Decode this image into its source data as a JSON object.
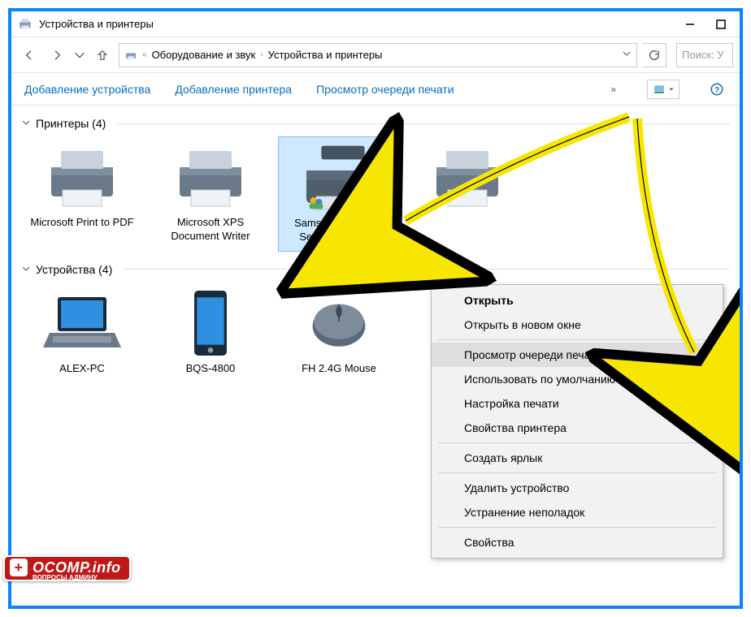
{
  "window": {
    "title": "Устройства и принтеры"
  },
  "breadcrumb": {
    "item1": "Оборудование и звук",
    "item2": "Устройства и принтеры"
  },
  "search": {
    "placeholder": "Поиск: У"
  },
  "toolbar": {
    "add_device": "Добавление устройства",
    "add_printer": "Добавление принтера",
    "view_queue": "Просмотр очереди печати"
  },
  "groups": {
    "printers": {
      "header": "Принтеры (4)",
      "items": [
        {
          "label": "Microsoft Print to PDF"
        },
        {
          "label": "Microsoft XPS Document Writer"
        },
        {
          "label": "Samsung ML-1860 Series (USB001)"
        },
        {
          "label": ""
        }
      ]
    },
    "devices": {
      "header": "Устройства (4)",
      "items": [
        {
          "label": "ALEX-PC"
        },
        {
          "label": "BQS-4800"
        },
        {
          "label": "FH 2.4G Mouse"
        },
        {
          "label": ""
        }
      ]
    }
  },
  "context_menu": {
    "open": "Открыть",
    "open_new": "Открыть в новом окне",
    "view_queue": "Просмотр очереди печати",
    "set_default": "Использовать по умолчанию",
    "print_setup": "Настройка печати",
    "printer_props": "Свойства принтера",
    "create_shortcut": "Создать ярлык",
    "remove_device": "Удалить устройство",
    "troubleshoot": "Устранение неполадок",
    "properties": "Свойства"
  },
  "watermark": {
    "text": "OCOMP.info",
    "sub": "ВОПРОСЫ АДМИНУ"
  }
}
